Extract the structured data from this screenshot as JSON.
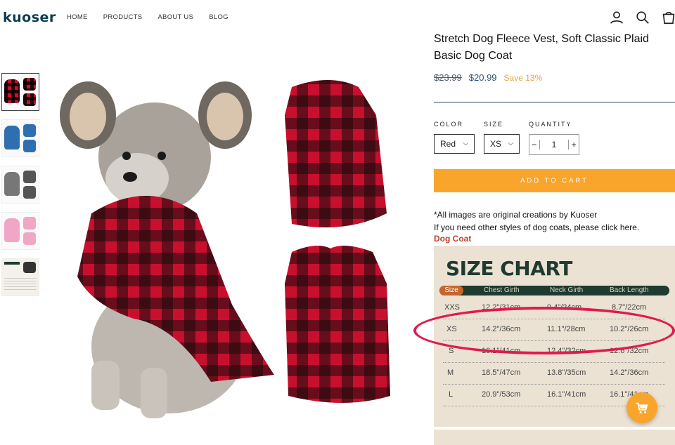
{
  "brand": {
    "logo": "kuoser"
  },
  "nav": {
    "items": [
      "HOME",
      "PRODUCTS",
      "ABOUT US",
      "BLOG"
    ]
  },
  "header_icons": [
    "account-icon",
    "search-icon",
    "cart-icon"
  ],
  "product": {
    "title": "Stretch Dog Fleece Vest, Soft Classic Plaid Basic Dog Coat",
    "old_price": "$23.99",
    "new_price": "$20.99",
    "save": "Save 13%"
  },
  "options": {
    "color_label": "COLOR",
    "color_value": "Red",
    "size_label": "SIZE",
    "size_value": "XS",
    "quantity_label": "QUANTITY",
    "quantity_value": "1",
    "minus": "−",
    "plus": "+"
  },
  "add_to_cart": "ADD TO CART",
  "note": {
    "line1": "*All images are original creations by Kuoser",
    "line2": "If you need other styles of dog coats, please click here.",
    "link": "Dog Coat"
  },
  "size_chart": {
    "title": "SIZE CHART",
    "headers": [
      "Size",
      "Chest Girth",
      "Neck Girth",
      "Back Length"
    ],
    "rows": [
      [
        "XXS",
        "12.2\"/31cm",
        "9.4\"/24cm",
        "8.7\"/22cm"
      ],
      [
        "XS",
        "14.2\"/36cm",
        "11.1\"/28cm",
        "10.2\"/26cm"
      ],
      [
        "S",
        "16.1\"/41cm",
        "12.4\"/32cm",
        "12.6\"/32cm"
      ],
      [
        "M",
        "18.5\"/47cm",
        "13.8\"/35cm",
        "14.2\"/36cm"
      ],
      [
        "L",
        "20.9\"/53cm",
        "16.1\"/41cm",
        "16.1\"/41cm"
      ]
    ]
  },
  "colors": {
    "accent": "#f9a52c",
    "brand": "#0b3d4f",
    "plaid_red": "#c8102e",
    "highlight": "#e01a4f"
  }
}
